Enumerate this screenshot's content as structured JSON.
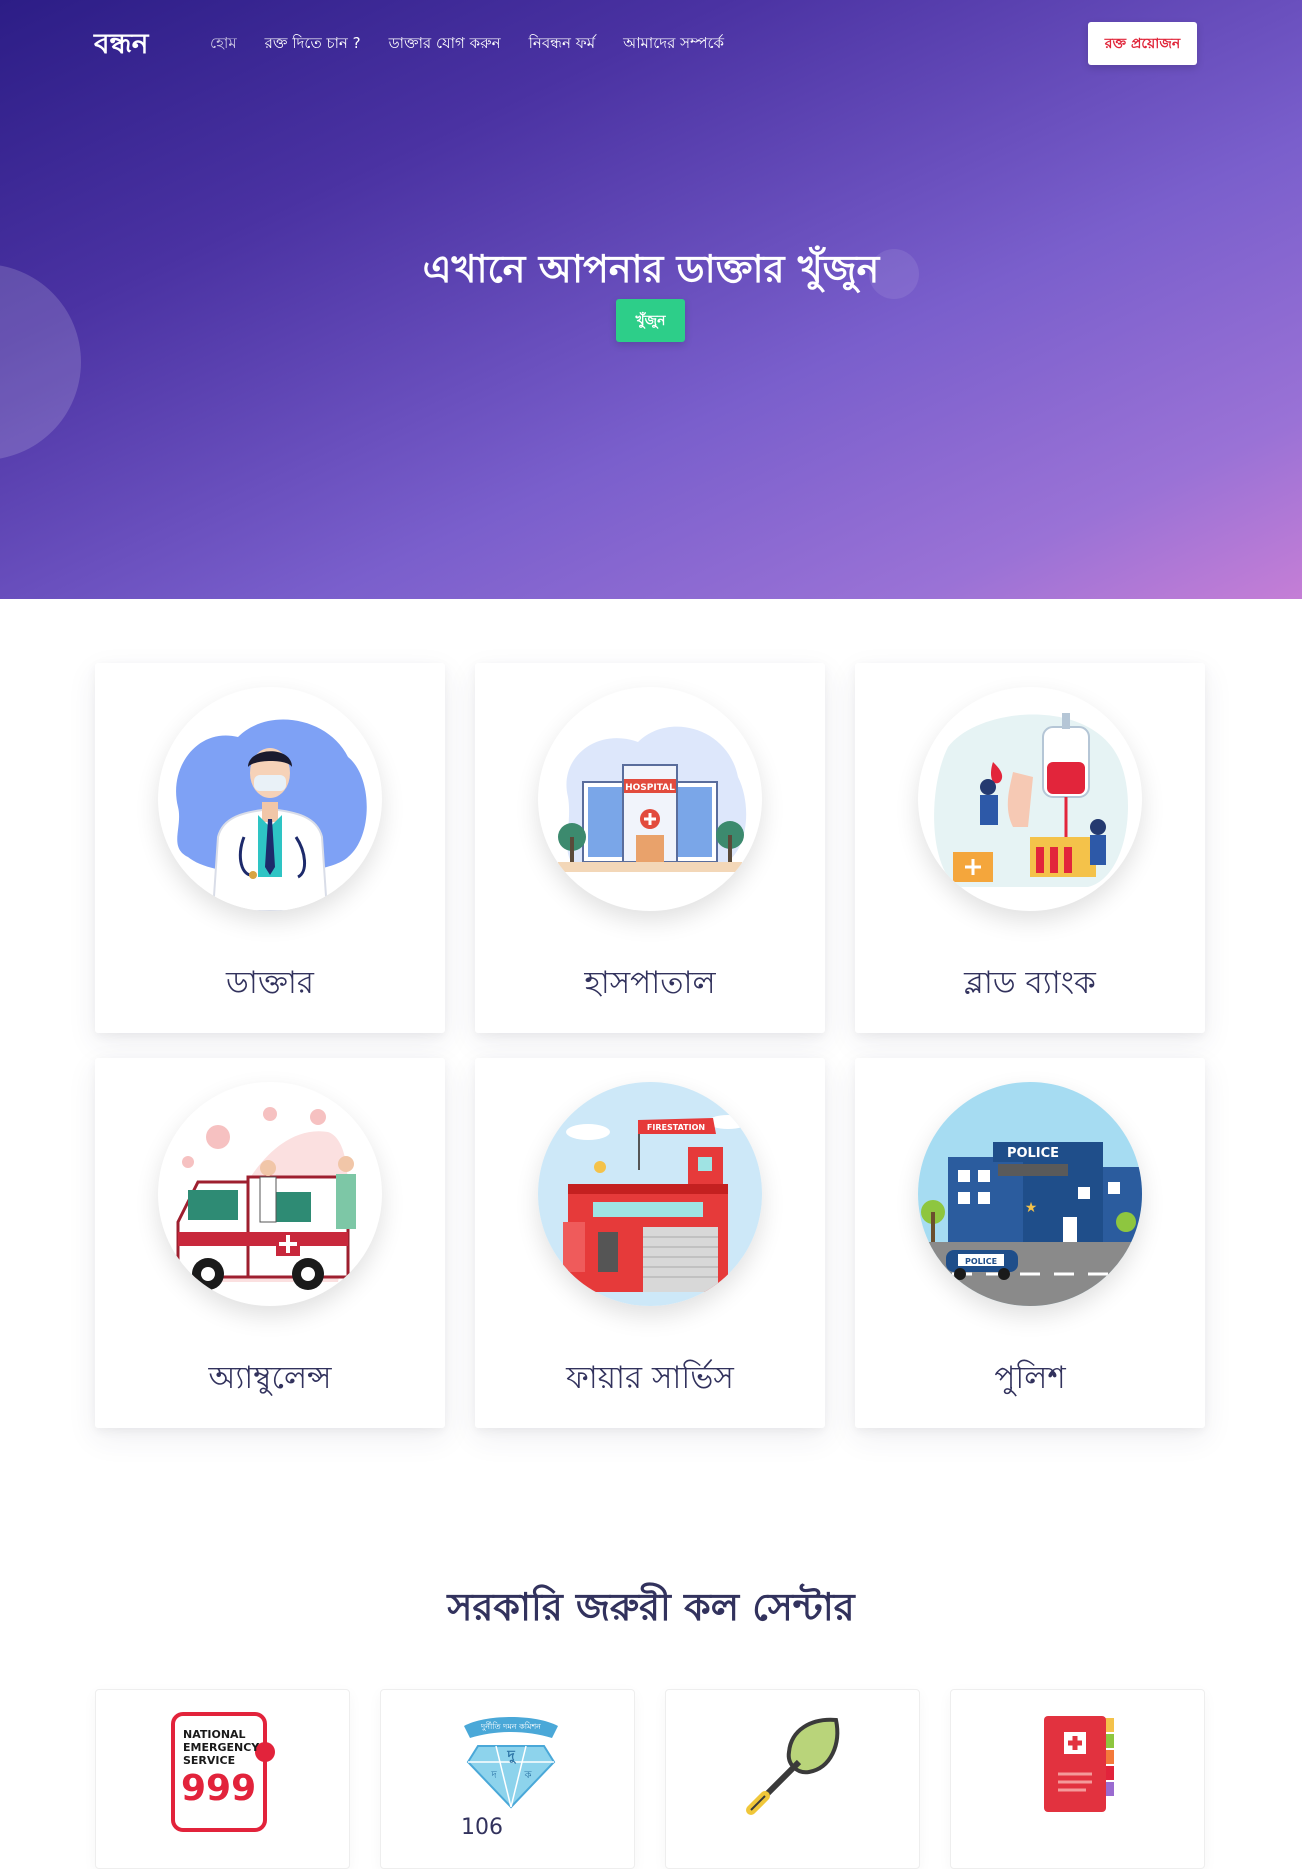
{
  "brand": "বন্ধন",
  "nav": {
    "links": [
      "হোম",
      "রক্ত দিতে চান ?",
      "ডাক্তার যোগ করুন",
      "নিবন্ধন ফর্ম",
      "আমাদের সম্পর্কে"
    ],
    "cta": "রক্ত প্রয়োজন"
  },
  "hero": {
    "title": "এখানে আপনার ডাক্তার খুঁজুন",
    "button": "খুঁজুন"
  },
  "services": [
    {
      "label": "ডাক্তার",
      "icon": "doctor-icon"
    },
    {
      "label": "হাসপাতাল",
      "icon": "hospital-icon",
      "sign": "HOSPITAL"
    },
    {
      "label": "ব্লাড ব্যাংক",
      "icon": "blood-bank-icon"
    },
    {
      "label": "অ্যাম্বুলেন্স",
      "icon": "ambulance-icon"
    },
    {
      "label": "ফায়ার সার্ভিস",
      "icon": "fire-station-icon",
      "sign": "FIRESTATION"
    },
    {
      "label": "পুলিশ",
      "icon": "police-station-icon",
      "sign": "POLICE",
      "car": "POLICE"
    }
  ],
  "emergency": {
    "title": "সরকারি জরুরী কল সেন্টার",
    "cards": [
      {
        "icon": "national-emergency-999-logo",
        "logo_text": [
          "NATIONAL",
          "EMERGENCY",
          "SERVICE"
        ],
        "number": "999"
      },
      {
        "icon": "anti-corruption-commission-logo",
        "logo_text": [
          "দুর্নীতি দমন কমিশন",
          "দু",
          "দ",
          "ক"
        ],
        "number": "106"
      },
      {
        "icon": "agriculture-trowel-icon"
      },
      {
        "icon": "health-book-icon"
      }
    ]
  },
  "colors": {
    "hero_start": "#2c1d86",
    "hero_end": "#c57ed6",
    "cta_text": "#e0263a",
    "search_button": "#2dce89",
    "heading": "#32325d"
  }
}
